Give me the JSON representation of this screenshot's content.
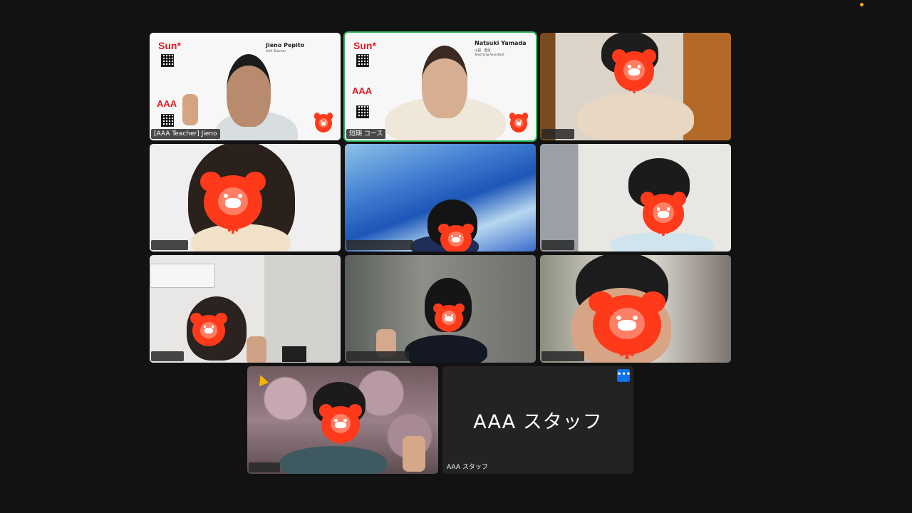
{
  "colors": {
    "background": "#121212",
    "active_border": "#2db45a",
    "mask_red": "#ff3a1a",
    "menu_button": "#0e72ed",
    "recording_dot": "#f6a623"
  },
  "participants": [
    {
      "label": "[AAA Teacher] Jieno",
      "slide_name": "Jieno Pepito",
      "slide_role": "AAA Teacher",
      "brand": "Sun*",
      "brand2": "AAA"
    },
    {
      "label": "短期 コース",
      "slide_name": "Natsuki Yamada",
      "slide_role": "Teaching Assistant",
      "slide_jp": "山田　夏生",
      "brand": "Sun*",
      "brand2": "AAA",
      "active": true
    },
    {
      "label": ""
    },
    {
      "label": ""
    },
    {
      "label": ""
    },
    {
      "label": ""
    },
    {
      "label": ""
    },
    {
      "label": ""
    },
    {
      "label": ""
    },
    {
      "label": ""
    },
    {
      "label": "AAA スタッフ",
      "display_name": "AAA スタッフ",
      "video_off": true,
      "menu_icon": "more-horizontal-icon",
      "menu_label": "•••"
    }
  ]
}
